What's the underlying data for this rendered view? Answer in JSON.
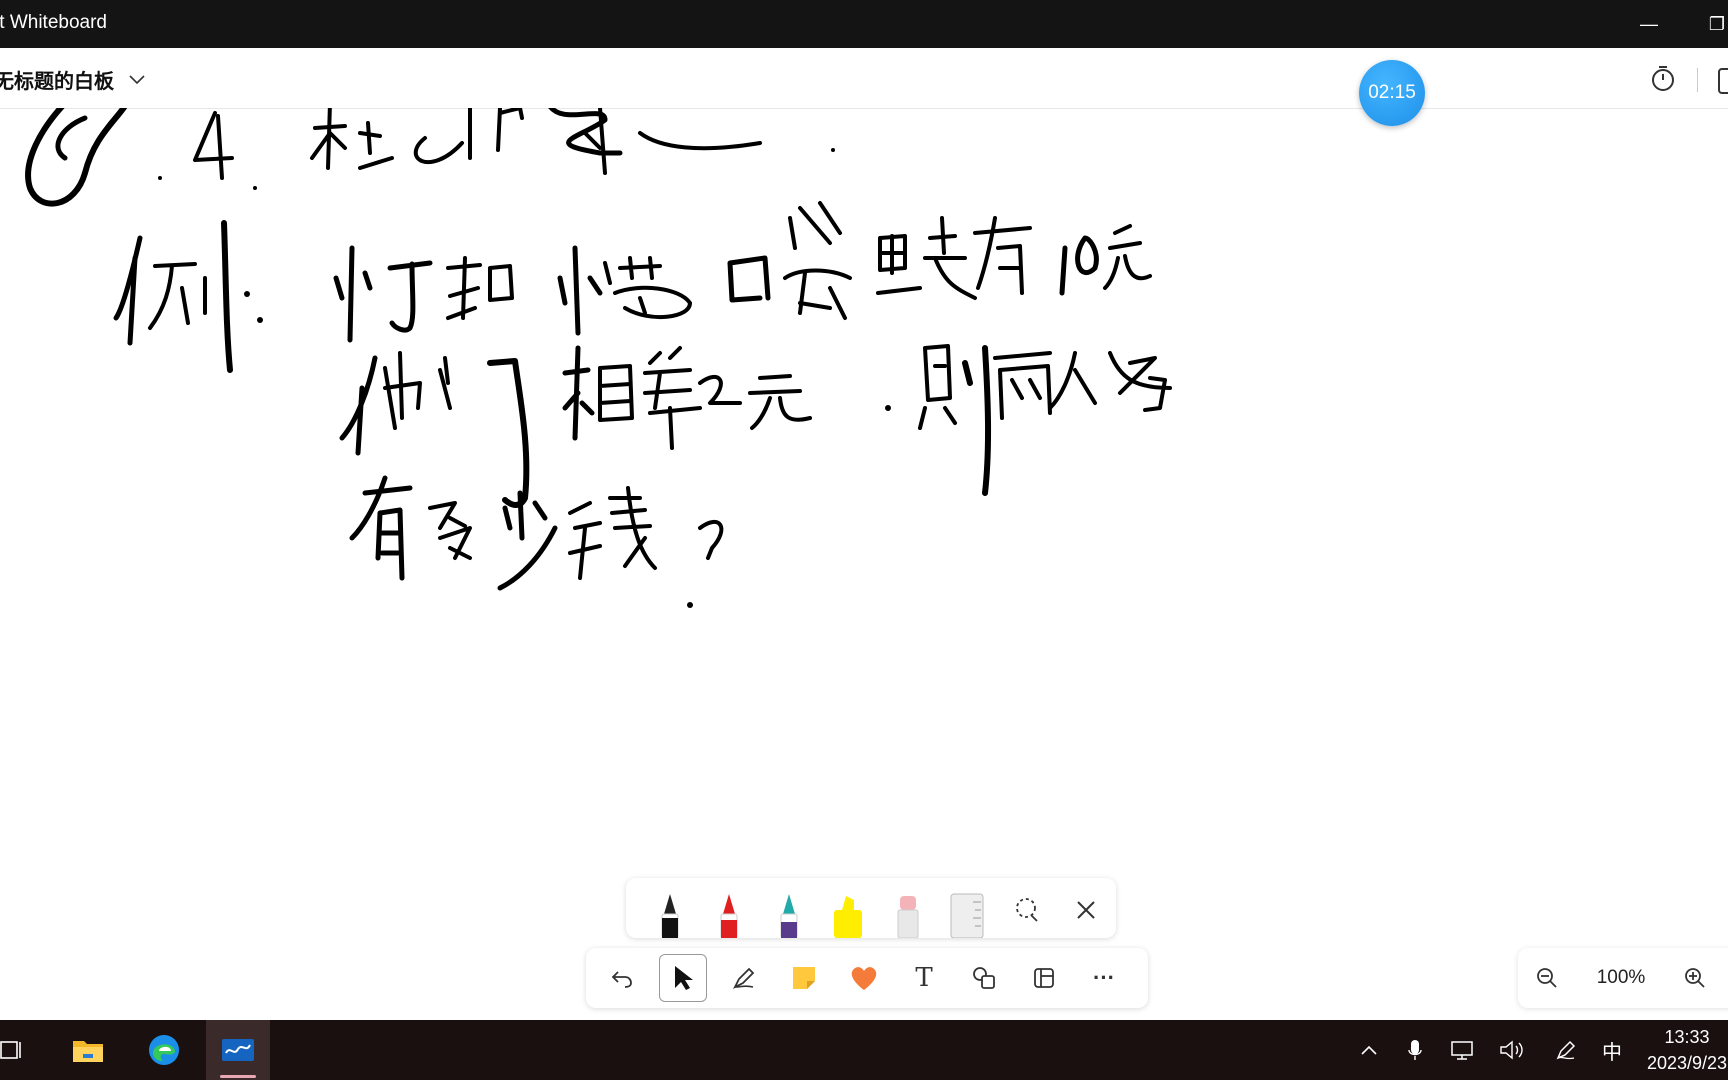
{
  "window": {
    "app_title": "ft Whiteboard",
    "minimize_glyph": "—",
    "restore_glyph": "❐"
  },
  "header": {
    "board_title": "无标题的白板",
    "timer_value": "02:15"
  },
  "canvas": {
    "content_type": "handwritten ink strokes",
    "ink_color": "#000000"
  },
  "pen_tray": {
    "pens": [
      {
        "name": "black-pen",
        "color": "#111111"
      },
      {
        "name": "red-pen",
        "color": "#e02020"
      },
      {
        "name": "galaxy-pen",
        "color": "#3a4a8a"
      },
      {
        "name": "highlighter",
        "color": "#ffee00"
      },
      {
        "name": "eraser",
        "color": "#f3b3b8"
      },
      {
        "name": "ruler",
        "color": "#e0e0e0"
      }
    ]
  },
  "toolbar": {
    "tools": [
      "undo",
      "select",
      "ink",
      "sticky-note",
      "reactions",
      "text",
      "shapes",
      "templates",
      "more"
    ],
    "text_glyph": "T",
    "more_glyph": "···"
  },
  "zoom": {
    "level": "100%"
  },
  "taskbar": {
    "ime_indicator": "中",
    "time": "13:33",
    "date": "2023/9/23"
  },
  "colors": {
    "titlebar": "#141414",
    "taskbar": "#1a1010",
    "timer_accent": "#1e8fe8",
    "active_app_indicator": "#e9a7b4"
  }
}
